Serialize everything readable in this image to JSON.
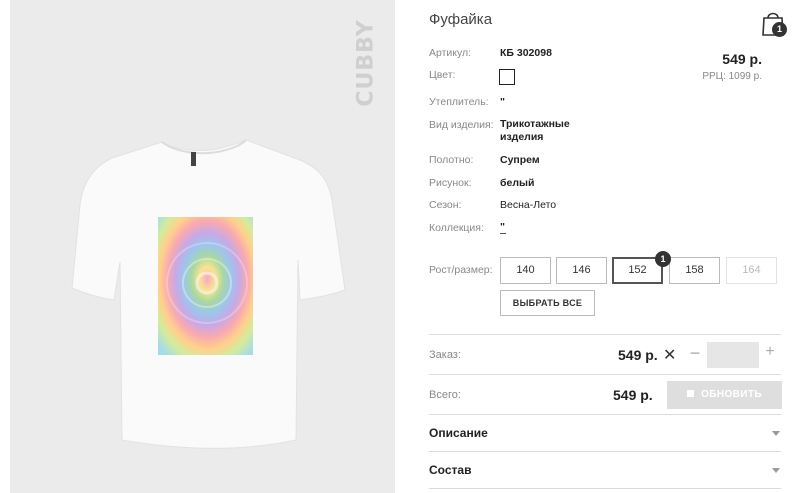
{
  "product": {
    "brand": "CUBBY",
    "title": "Фуфайка",
    "price": "549 р.",
    "rrp": "РРЦ: 1099 р."
  },
  "cart": {
    "count": "1",
    "icon": "shopping-bag-icon"
  },
  "attributes": [
    {
      "label": "Артикул:",
      "value": "КБ 302098"
    },
    {
      "label": "Цвет:",
      "value": ""
    },
    {
      "label": "Утеплитель:",
      "value": "\""
    },
    {
      "label": "Вид изделия:",
      "value": "Трикотажные изделия"
    },
    {
      "label": "Полотно:",
      "value": "Супрем"
    },
    {
      "label": "Рисунок:",
      "value": "белый"
    },
    {
      "label": "Сезон:",
      "value": "Весна-Лето"
    },
    {
      "label": "Коллекция:",
      "value": "\""
    }
  ],
  "sizes": {
    "label": "Рост/размер:",
    "items": [
      {
        "value": "140",
        "state": "normal"
      },
      {
        "value": "146",
        "state": "normal"
      },
      {
        "value": "152",
        "state": "selected"
      },
      {
        "value": "158",
        "state": "normal"
      },
      {
        "value": "164",
        "state": "disabled"
      }
    ],
    "selected_count": "1",
    "select_all_label": "ВЫБРАТЬ ВСЕ"
  },
  "order": {
    "label": "Заказ:",
    "price": "549 р.",
    "remove_symbol": "✕",
    "minus": "−",
    "plus": "+",
    "quantity": ""
  },
  "total": {
    "label": "Всего:",
    "price": "549 р.",
    "update_label": "ОБНОВИТЬ"
  },
  "accordion": [
    {
      "label": "Описание"
    },
    {
      "label": "Состав"
    }
  ],
  "colors": {
    "selected_border": "#555555",
    "badge": "#333333",
    "update_button_bg": "#dedede",
    "photo_bg": "#ebebeb"
  }
}
